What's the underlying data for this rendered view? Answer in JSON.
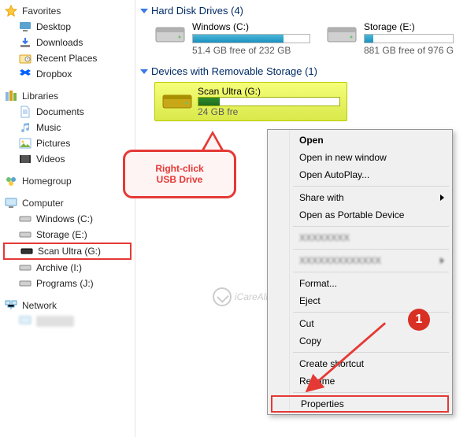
{
  "sidebar": {
    "favorites": {
      "label": "Favorites",
      "items": [
        {
          "label": "Desktop"
        },
        {
          "label": "Downloads"
        },
        {
          "label": "Recent Places"
        },
        {
          "label": "Dropbox"
        }
      ]
    },
    "libraries": {
      "label": "Libraries",
      "items": [
        {
          "label": "Documents"
        },
        {
          "label": "Music"
        },
        {
          "label": "Pictures"
        },
        {
          "label": "Videos"
        }
      ]
    },
    "homegroup": {
      "label": "Homegroup"
    },
    "computer": {
      "label": "Computer",
      "items": [
        {
          "label": "Windows (C:)"
        },
        {
          "label": "Storage (E:)"
        },
        {
          "label": "Scan Ultra (G:)"
        },
        {
          "label": "Archive (I:)"
        },
        {
          "label": "Programs (J:)"
        }
      ]
    },
    "network": {
      "label": "Network"
    }
  },
  "main": {
    "hd_header": "Hard Disk Drives (4)",
    "removable_header": "Devices with Removable Storage (1)",
    "drives": [
      {
        "name": "Windows (C:)",
        "info": "51.4 GB free of 232 GB",
        "fill": 78
      },
      {
        "name": "Storage (E:)",
        "info": "881 GB free of 976 G",
        "fill": 10
      }
    ],
    "removable": {
      "name": "Scan Ultra (G:)",
      "info": "24    GB fre",
      "fill": 15
    }
  },
  "context_menu": {
    "open": "Open",
    "open_new": "Open in new window",
    "autoplay": "Open AutoPlay...",
    "share": "Share with",
    "portable": "Open as Portable Device",
    "format": "Format...",
    "eject": "Eject",
    "cut": "Cut",
    "copy": "Copy",
    "shortcut": "Create shortcut",
    "rename": "Rename",
    "properties": "Properties"
  },
  "callout": {
    "line1": "Right-click",
    "line2": "USB Drive"
  },
  "badge": "1",
  "watermark": "iCareAll.com"
}
